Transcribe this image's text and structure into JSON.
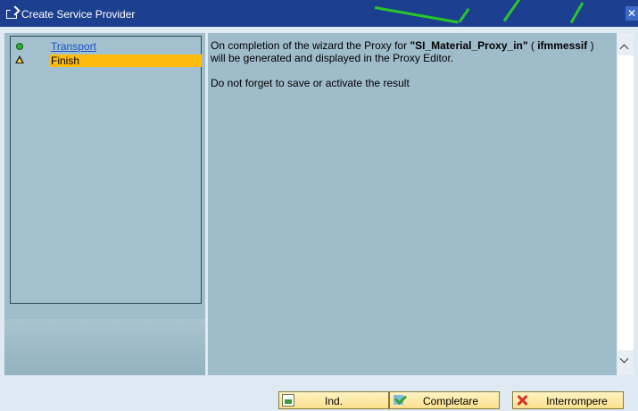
{
  "window": {
    "title": "Create Service Provider",
    "close_glyph": "✕"
  },
  "nav": {
    "items": [
      {
        "label": "Transport",
        "status": "green-dot",
        "state": "link"
      },
      {
        "label": "Finish",
        "status": "warning-triangle",
        "state": "active"
      }
    ]
  },
  "content": {
    "msg1_prefix": "On completion of the wizard the Proxy for ",
    "proxy_name": "\"SI_Material_Proxy_in\"",
    "msg1_mid": " ( ",
    "namespace": "ifmmessif",
    "msg1_suffix": " )",
    "msg1_line2": "will be generated and displayed in the Proxy Editor.",
    "msg2": "Do not forget to save or activate the result"
  },
  "buttons": {
    "back": {
      "label": "Ind.",
      "icon": "document-back-icon"
    },
    "complete": {
      "label": "Completare",
      "icon": "checkmark-icon"
    },
    "cancel": {
      "label": "Interrompere",
      "icon": "cancel-x-icon"
    }
  },
  "colors": {
    "titlebar": "#1d3f8f",
    "panel": "#9fbccb",
    "active_item": "#ffbc0d",
    "link": "#1d52c8",
    "button": "#fbe18d"
  }
}
